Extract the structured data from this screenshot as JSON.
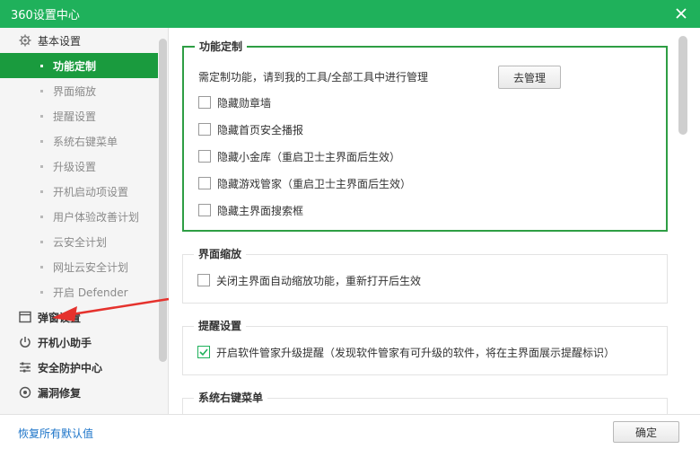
{
  "window": {
    "title": "360设置中心",
    "accent": "#1fb15b",
    "active_color": "#1a9b3e"
  },
  "sidebar": {
    "sections": [
      {
        "label": "基本设置",
        "icon": "gear-icon"
      },
      {
        "label": "弹窗设置",
        "icon": "window-icon"
      },
      {
        "label": "开机小助手",
        "icon": "power-icon"
      },
      {
        "label": "安全防护中心",
        "icon": "sliders-icon"
      },
      {
        "label": "漏洞修复",
        "icon": "patch-icon"
      }
    ],
    "items": [
      {
        "label": "功能定制",
        "active": true
      },
      {
        "label": "界面缩放"
      },
      {
        "label": "提醒设置"
      },
      {
        "label": "系统右键菜单"
      },
      {
        "label": "升级设置"
      },
      {
        "label": "开机启动项设置"
      },
      {
        "label": "用户体验改善计划"
      },
      {
        "label": "云安全计划"
      },
      {
        "label": "网址云安全计划"
      },
      {
        "label": "开启 Defender"
      }
    ]
  },
  "groups": {
    "func": {
      "title": "功能定制",
      "desc": "需定制功能，请到我的工具/全部工具中进行管理",
      "manage_label": "去管理",
      "options": [
        {
          "label": "隐藏勋章墙",
          "checked": false
        },
        {
          "label": "隐藏首页安全播报",
          "checked": false
        },
        {
          "label": "隐藏小金库（重启卫士主界面后生效）",
          "checked": false
        },
        {
          "label": "隐藏游戏管家（重启卫士主界面后生效）",
          "checked": false
        },
        {
          "label": "隐藏主界面搜索框",
          "checked": false
        }
      ]
    },
    "zoom": {
      "title": "界面缩放",
      "options": [
        {
          "label": "关闭主界面自动缩放功能，重新打开后生效",
          "checked": false
        }
      ]
    },
    "remind": {
      "title": "提醒设置",
      "options": [
        {
          "label": "开启软件管家升级提醒（发现软件管家有可升级的软件，将在主界面展示提醒标识）",
          "checked": true
        }
      ]
    },
    "context": {
      "title": "系统右键菜单"
    }
  },
  "footer": {
    "reset_label": "恢复所有默认值",
    "ok_label": "确定"
  }
}
